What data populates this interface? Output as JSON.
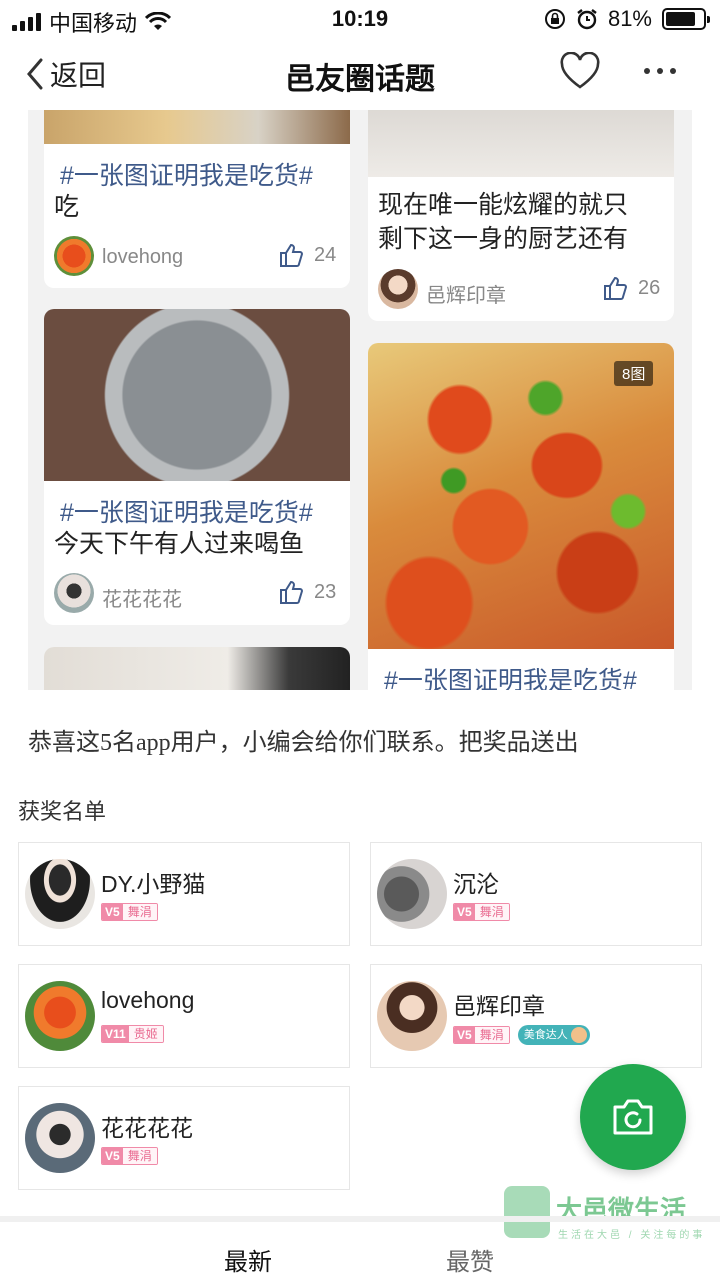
{
  "status_bar": {
    "carrier": "中国移动",
    "time": "10:19",
    "battery_percent": "81%",
    "battery_level": 0.81
  },
  "nav": {
    "back_label": "返回",
    "title": "邑友圈话题"
  },
  "feed": {
    "topic": "#一张图证明我是吃货#",
    "photo_count": "8图",
    "posts": [
      {
        "text": "吃",
        "user": "lovehong",
        "likes": "24"
      },
      {
        "text_lines": [
          "现在唯一能炫耀的就只",
          "剩下这一身的厨艺还有"
        ],
        "user": "邑辉印章",
        "likes": "26"
      },
      {
        "text": "今天下午有人过来喝鱼",
        "user": "花花花花",
        "likes": "23"
      }
    ]
  },
  "congrats_text": "恭喜这5名app用户，小编会给你们联系。把奖品送出",
  "winners_label": "获奖名单",
  "winners": [
    {
      "name": "DY.小野猫",
      "level": "V5",
      "title": "舞涓"
    },
    {
      "name": "沉沦",
      "level": "V5",
      "title": "舞涓"
    },
    {
      "name": "lovehong",
      "level": "V11",
      "title": "贵姬"
    },
    {
      "name": "邑辉印章",
      "level": "V5",
      "title": "舞涓",
      "extra_badge": "美食达人"
    },
    {
      "name": "花花花花",
      "level": "V5",
      "title": "舞涓"
    }
  ],
  "watermark": {
    "name": "大邑微生活",
    "slogan": "生活在大邑 / 关注每的事"
  },
  "tabs": {
    "latest": "最新",
    "most_liked": "最赞"
  },
  "colors": {
    "accent_green": "#21a84f",
    "topic_blue": "#3f5a8a",
    "badge_pink": "#f08aa8"
  }
}
